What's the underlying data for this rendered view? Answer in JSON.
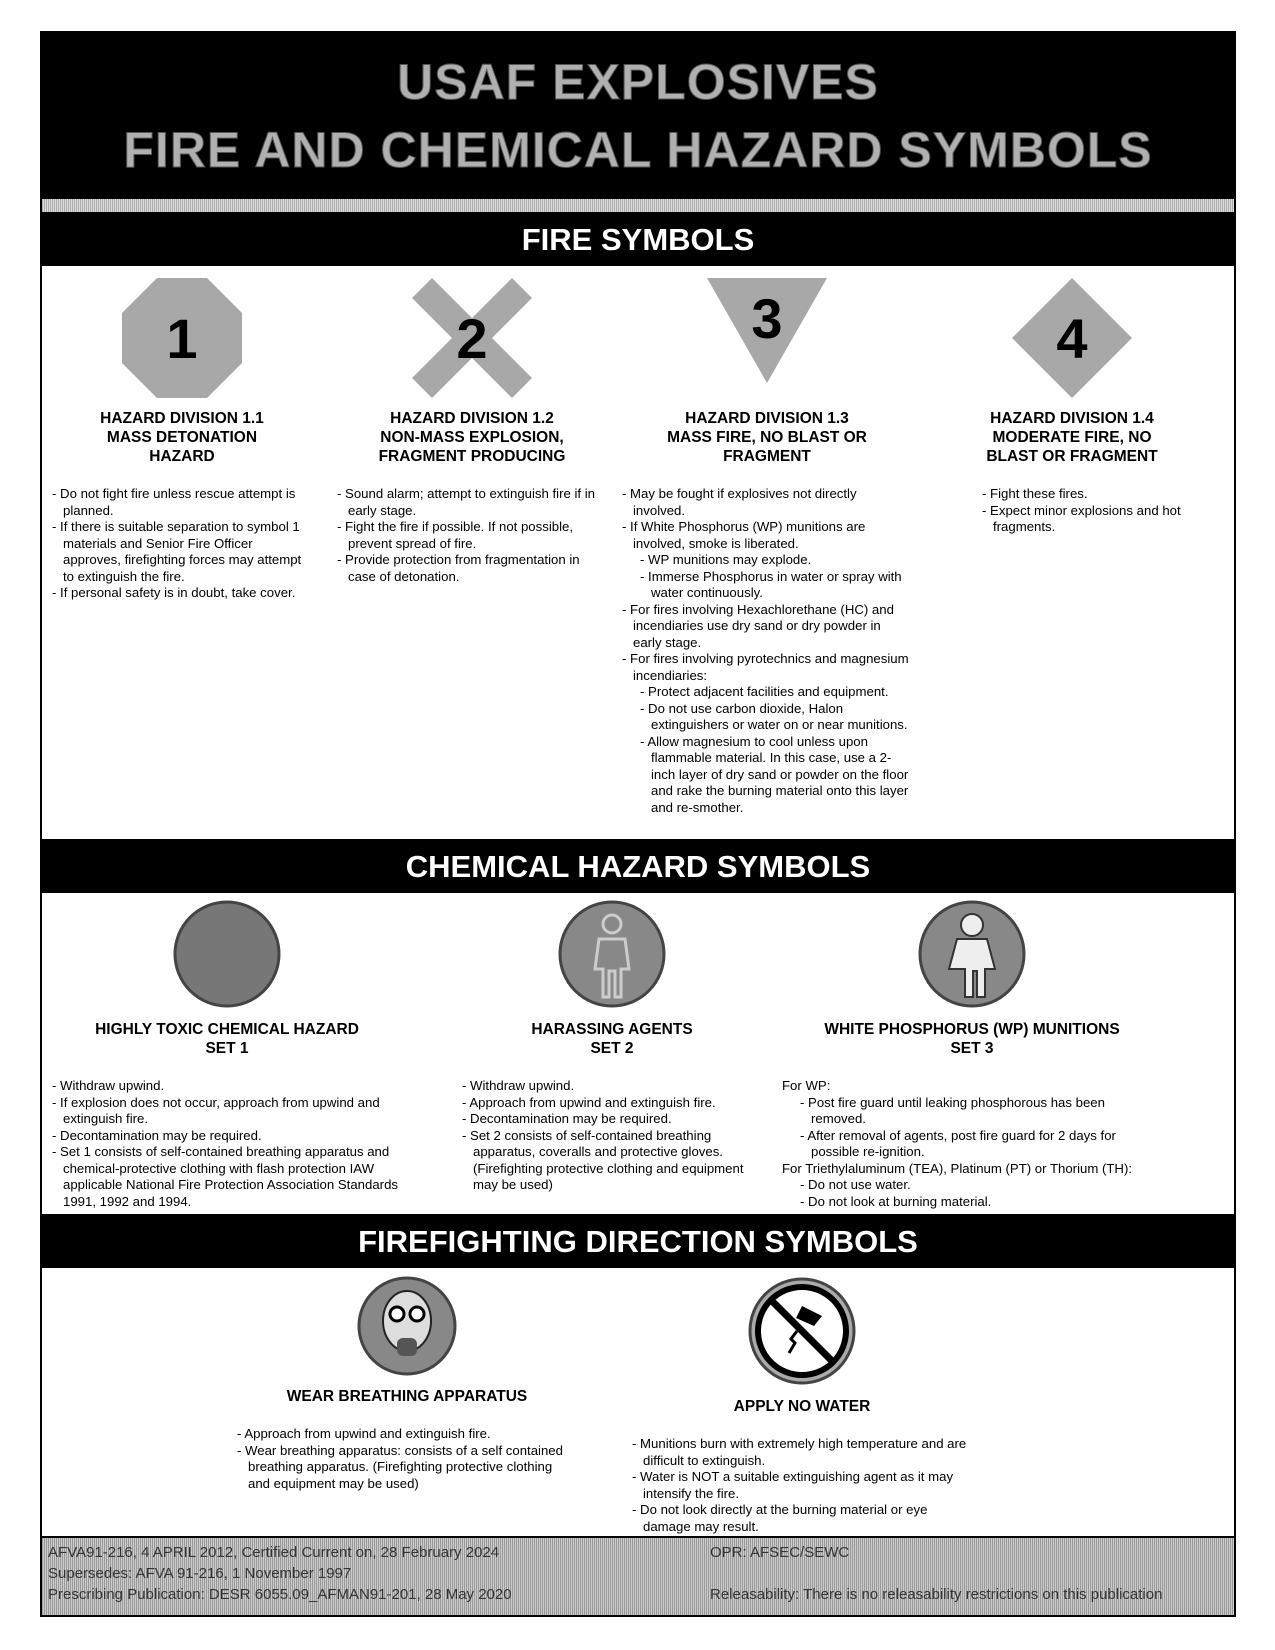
{
  "title": {
    "line1": "USAF EXPLOSIVES",
    "line2": "FIRE AND CHEMICAL HAZARD SYMBOLS"
  },
  "fire": {
    "header": "FIRE SYMBOLS",
    "items": [
      {
        "number": "1",
        "shape": "octagon",
        "t1": "HAZARD DIVISION 1.1",
        "t2": "MASS DETONATION",
        "t3": "HAZARD",
        "bullets": [
          "- Do not fight fire unless rescue attempt is planned.",
          "- If there is suitable separation to symbol 1 materials and Senior Fire Officer approves, firefighting forces may attempt to extinguish the fire.",
          "- If personal safety is in doubt, take cover."
        ]
      },
      {
        "number": "2",
        "shape": "cross",
        "t1": "HAZARD DIVISION 1.2",
        "t2": "NON-MASS EXPLOSION,",
        "t3": "FRAGMENT PRODUCING",
        "bullets": [
          "- Sound alarm; attempt to extinguish fire if in early stage.",
          "- Fight the fire if possible.  If not possible, prevent spread of fire.",
          "- Provide protection from fragmentation in case of detonation."
        ]
      },
      {
        "number": "3",
        "shape": "inverted-triangle",
        "t1": "HAZARD DIVISION 1.3",
        "t2": "MASS FIRE, NO BLAST OR",
        "t3": "FRAGMENT",
        "bullets": [
          "- May be fought if explosives not directly involved.",
          "- If White Phosphorus (WP) munitions are involved, smoke is liberated.",
          "- WP munitions may explode.",
          "- Immerse Phosphorus in water or spray with water continuously.",
          "- For fires involving Hexachlorethane (HC) and incendiaries use dry sand or dry powder in early stage.",
          "- For fires involving pyrotechnics and magnesium incendiaries:",
          "- Protect adjacent facilities and equipment.",
          "- Do not use carbon dioxide, Halon extinguishers or water on or near munitions.",
          "- Allow magnesium to cool unless upon flammable material. In this case, use a 2-inch layer of dry sand or powder on the floor and rake the burning material onto this layer and re-smother."
        ]
      },
      {
        "number": "4",
        "shape": "diamond",
        "t1": "HAZARD DIVISION 1.4",
        "t2": "MODERATE FIRE, NO",
        "t3": "BLAST OR FRAGMENT",
        "bullets": [
          "- Fight these fires.",
          "- Expect minor explosions and hot fragments."
        ]
      }
    ]
  },
  "chemical": {
    "header": "CHEMICAL HAZARD SYMBOLS",
    "items": [
      {
        "icon": "toxic-circle",
        "t1": "HIGHLY TOXIC CHEMICAL HAZARD",
        "t2": "SET 1",
        "bullets": [
          "- Withdraw upwind.",
          "- If explosion does not occur, approach from upwind and extinguish fire.",
          "- Decontamination may be required.",
          "- Set 1 consists of self-contained breathing apparatus and chemical-protective clothing with flash protection IAW applicable National Fire Protection Association Standards 1991, 1992 and 1994."
        ]
      },
      {
        "icon": "coverall-person",
        "t1": "HARASSING AGENTS",
        "t2": "SET 2",
        "bullets": [
          "- Withdraw upwind.",
          "- Approach from upwind and extinguish fire.",
          "- Decontamination may be required.",
          "- Set 2 consists of self-contained breathing apparatus, coveralls and protective gloves. (Firefighting protective clothing and equipment may be used)"
        ]
      },
      {
        "icon": "suited-person",
        "t1": "WHITE PHOSPHORUS (WP) MUNITIONS",
        "t2": "SET 3",
        "bullets": [
          "For WP:",
          "- Post fire guard until leaking phosphorous has been removed.",
          "- After removal of agents, post fire guard for 2 days for possible re-ignition.",
          "For Triethylaluminum (TEA), Platinum (PT) or Thorium (TH):",
          "- Do not use water.",
          "- Do not look at burning material."
        ]
      }
    ]
  },
  "direction": {
    "header": "FIREFIGHTING DIRECTION SYMBOLS",
    "items": [
      {
        "icon": "gas-mask",
        "t1": "WEAR BREATHING APPARATUS",
        "bullets": [
          "- Approach from upwind and extinguish fire.",
          "- Wear breathing apparatus: consists of a self contained breathing apparatus.  (Firefighting protective clothing and equipment may be used)"
        ]
      },
      {
        "icon": "no-water",
        "t1": "APPLY NO WATER",
        "bullets": [
          "- Munitions burn with extremely high temperature and are difficult to extinguish.",
          "- Water is NOT a suitable extinguishing agent as it may intensify the fire.",
          "- Do not look directly at the burning material or eye damage may result."
        ]
      }
    ]
  },
  "footer": {
    "l1": "AFVA91-216, 4 APRIL 2012, Certified Current on, 28 February 2024",
    "l2": "Supersedes:  AFVA 91-216, 1 November 1997",
    "l3": "Prescribing Publication:  DESR 6055.09_AFMAN91-201, 28 May 2020",
    "r1": "OPR:  AFSEC/SEWC",
    "r2": "Releasability: There is no releasability restrictions on this publication"
  }
}
